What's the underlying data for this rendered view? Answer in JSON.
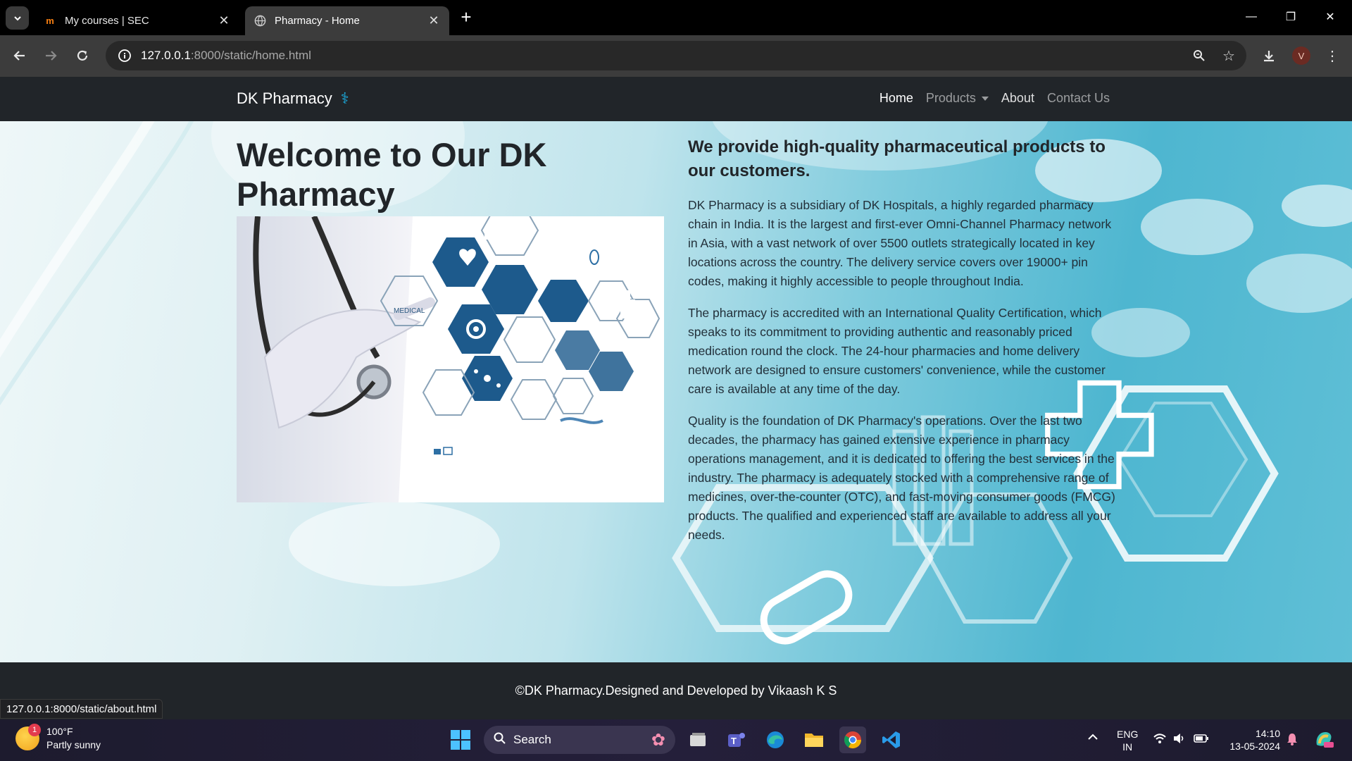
{
  "browser": {
    "tabs": [
      {
        "title": "My courses | SEC",
        "active": false,
        "icon": "moodle-icon"
      },
      {
        "title": "Pharmacy - Home",
        "active": true,
        "icon": "globe-icon"
      }
    ],
    "url_host": "127.0.0.1",
    "url_rest": ":8000/static/home.html",
    "profile_initial": "V"
  },
  "site": {
    "brand": "DK Pharmacy",
    "brand_icon": "⚕",
    "nav": {
      "home": "Home",
      "products": "Products",
      "about": "About",
      "contact": "Contact Us"
    },
    "hero": {
      "heading": "Welcome to Our DK Pharmacy",
      "subheading": "We provide high-quality pharmaceutical products to our customers.",
      "paragraphs": [
        "DK Pharmacy is a subsidiary of DK Hospitals, a highly regarded pharmacy chain in India. It is the largest and first-ever Omni-Channel Pharmacy network in Asia, with a vast network of over 5500 outlets strategically located in key locations across the country. The delivery service covers over 19000+ pin codes, making it highly accessible to people throughout India.",
        "The pharmacy is accredited with an International Quality Certification, which speaks to its commitment to providing authentic and reasonably priced medication round the clock. The 24-hour pharmacies and home delivery network are designed to ensure customers' convenience, while the customer care is available at any time of the day.",
        "Quality is the foundation of DK Pharmacy's operations. Over the last two decades, the pharmacy has gained extensive experience in pharmacy operations management, and it is dedicated to offering the best services in the industry. The pharmacy is adequately stocked with a comprehensive range of medicines, over-the-counter (OTC), and fast-moving consumer goods (FMCG) products. The qualified and experienced staff are available to address all your needs."
      ],
      "image_label": "MEDICAL"
    },
    "footer": "©DK Pharmacy.Designed and Developed by Vikaash K S"
  },
  "status_url": "127.0.0.1:8000/static/about.html",
  "taskbar": {
    "weather_temp": "100°F",
    "weather_desc": "Partly sunny",
    "weather_badge": "1",
    "search": "Search",
    "lang_top": "ENG",
    "lang_bottom": "IN",
    "time": "14:10",
    "date": "13-05-2024"
  }
}
